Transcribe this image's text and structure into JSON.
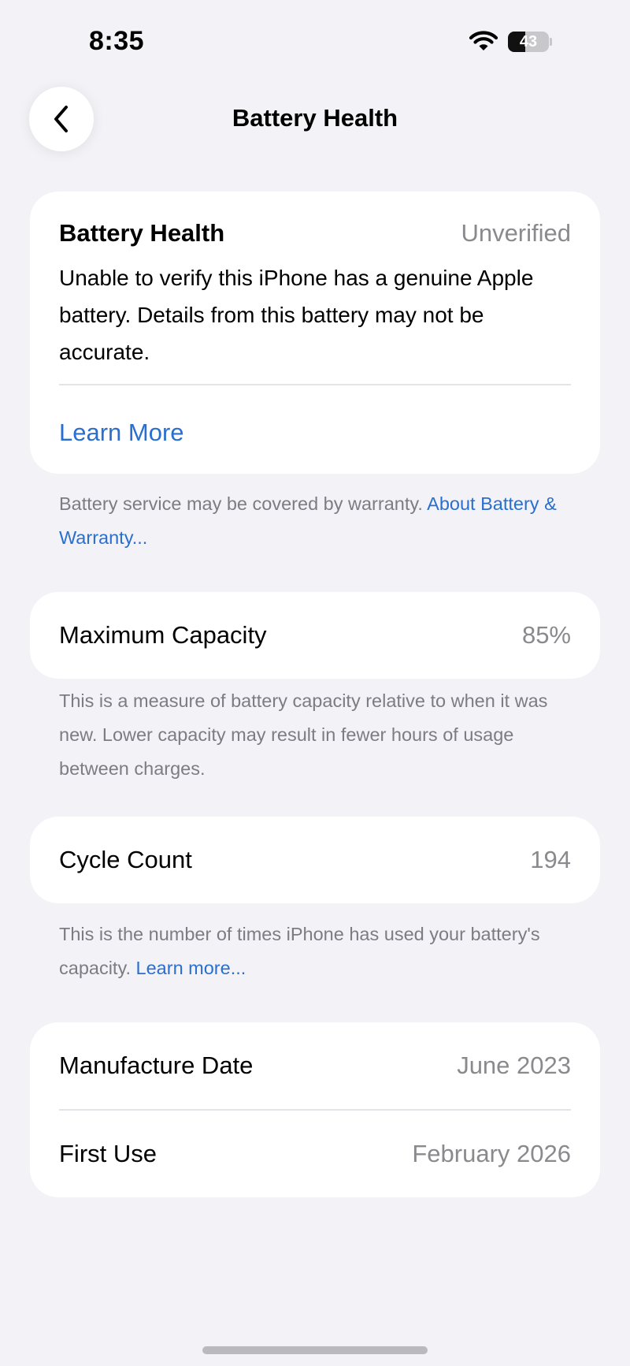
{
  "status_bar": {
    "time": "8:35",
    "battery_level": "43",
    "battery_fraction": 0.43
  },
  "nav": {
    "title": "Battery Health",
    "back_icon": "chevron-left-icon"
  },
  "health_card": {
    "title": "Battery Health",
    "status": "Unverified",
    "description": "Unable to verify this iPhone has a genuine Apple battery. Details from this battery may not be accurate.",
    "learn_more": "Learn More"
  },
  "warranty_note": {
    "text": "Battery service may be covered by warranty. ",
    "link": "About Battery & Warranty..."
  },
  "max_capacity": {
    "label": "Maximum Capacity",
    "value": "85%",
    "note": "This is a measure of battery capacity relative to when it was new. Lower capacity may result in fewer hours of usage between charges."
  },
  "cycle_count": {
    "label": "Cycle Count",
    "value": "194",
    "note_text": "This is the number of times iPhone has used your battery's capacity. ",
    "note_link": "Learn more..."
  },
  "dates": {
    "manufacture_label": "Manufacture Date",
    "manufacture_value": "June 2023",
    "first_use_label": "First Use",
    "first_use_value": "February 2026"
  },
  "colors": {
    "background": "#f2f2f7",
    "link": "#2a6fcf",
    "secondary_text": "#8a8a8e"
  }
}
